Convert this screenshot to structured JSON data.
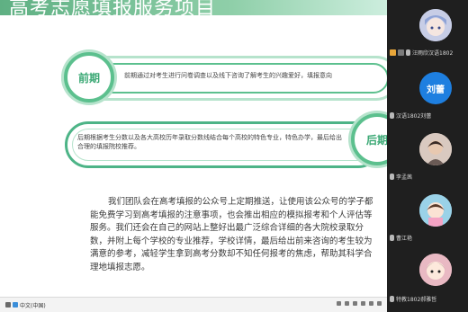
{
  "slide": {
    "title": "高考志愿填报服务项目",
    "section1": {
      "label": "前期",
      "text": "前期通过对考生进行问卷调查以及线下咨询了解考生的兴趣爱好，填报意向"
    },
    "section2": {
      "label": "后期",
      "text": "后期根据考生分数以及各大高校历年录取分数线结合每个高校的特色专业，特色办学，最后给出合理的填报院校推荐。"
    },
    "paragraph": "我们团队会在高考填报的公众号上定期推送，让使用该公众号的学子都能免费学习到高考填报的注意事项，也会推出相应的模拟报考和个人评估等服务。我们还会在自己的网站上整好出最广泛综合详细的各大院校录取分数，并附上每个学校的专业推荐，学校详情，最后给出前来咨询的考生较为满意的参考，减轻学生拿到高考分数却不知任何报考的焦虑，帮助其科学合理地填报志愿。"
  },
  "taskbar": {
    "language": "中文(中国)"
  },
  "participants": [
    {
      "name": "汪雨欣汉语1802",
      "avatar": "anime-girl",
      "color": "#c7cde6"
    },
    {
      "name": "汉语1802刘蕾",
      "avatar_text": "刘蕾",
      "color": "#1e7fe0"
    },
    {
      "name": "李孟茜",
      "avatar": "photo",
      "color": "#d9c9c0"
    },
    {
      "name": "曹江艳",
      "avatar": "cartoon-girl",
      "color": "#9ad2e8"
    },
    {
      "name": "特教1802郝雅哲",
      "avatar": "cartoon-face",
      "color": "#e9b9c3"
    }
  ]
}
